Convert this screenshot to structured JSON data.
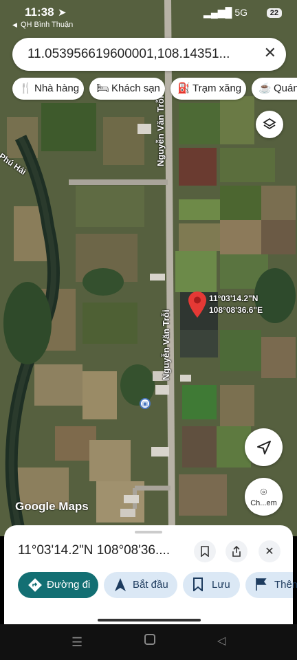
{
  "status_bar": {
    "time": "11:38",
    "location": "QH Bình Thuận",
    "network": "5G",
    "battery": "22"
  },
  "search": {
    "query": "11.053956619600001,108.14351..."
  },
  "chips": [
    {
      "label": "Nhà hàng",
      "icon": "restaurant-icon"
    },
    {
      "label": "Khách sạn",
      "icon": "hotel-icon"
    },
    {
      "label": "Trạm xăng",
      "icon": "gas-station-icon"
    },
    {
      "label": "Quán",
      "icon": "cafe-icon"
    }
  ],
  "map": {
    "road_labels": [
      "Nguyễn Văn Trỗi",
      "Nguyễn Văn Trỗi",
      "Phú Hải"
    ],
    "pin_coords": {
      "lat": "11°03'14.2\"N",
      "lng": "108°08'36.6\"E"
    },
    "logo": "Google Maps",
    "screenshot_button_label": "Ch...em"
  },
  "sheet": {
    "title": "11°03'14.2\"N 108°08'36....",
    "actions": [
      {
        "label": "Đường đi",
        "icon": "directions-icon"
      },
      {
        "label": "Bắt đầu",
        "icon": "navigate-icon"
      },
      {
        "label": "Lưu",
        "icon": "bookmark-icon"
      },
      {
        "label": "Thêm",
        "icon": "flag-icon"
      }
    ]
  },
  "colors": {
    "accent": "#136f73",
    "pin": "#e53935",
    "chip_bg": "#ffffff",
    "action_bg": "#dbe8f5"
  }
}
